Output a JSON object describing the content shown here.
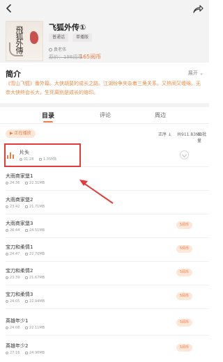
{
  "book": {
    "title": "飞狐外传①",
    "cover_text": "飛狐外傳",
    "tags": [
      "普通话",
      "单播版"
    ],
    "author": "袁老伟",
    "original_price": "原价：198阅币",
    "price": "165阅币"
  },
  "intro": {
    "heading": "简介",
    "expand_label": "展开",
    "text": "《雪山飞狐》番外篇。大侠胡斐的成长之路。江湖纷争夹杂着三角关系。又热闹又缠绵。无奈大侠终会长大，生死离别是成长的烙印。"
  },
  "tabs": [
    {
      "label": "目录"
    },
    {
      "label": "评论"
    },
    {
      "label": "周边"
    }
  ],
  "controls": {
    "play_label": "▶ 正在播放",
    "order_label": "正序 ↓",
    "total_label": "共911.83MB",
    "batch_label": "☰ 批量"
  },
  "episodes": [
    {
      "title": "片头",
      "duration": "01:28",
      "size": "1.35MB",
      "paid": ""
    },
    {
      "title": "大雨商家堡1",
      "duration": "24:36",
      "size": "22.31MB",
      "paid": ""
    },
    {
      "title": "大雨商家堡2",
      "duration": "23:42",
      "size": "21.71MB",
      "paid": ""
    },
    {
      "title": "大雨商家堡3",
      "duration": "26:44",
      "size": "24.51MB",
      "paid": "5阅币"
    },
    {
      "title": "宝刀和柔情1",
      "duration": "24:47",
      "size": "22.70MB",
      "paid": "5阅币"
    },
    {
      "title": "宝刀和柔情2",
      "duration": "23:39",
      "size": "21.67MB",
      "paid": "5阅币"
    },
    {
      "title": "宝刀和柔情3",
      "duration": "24:05",
      "size": "22.04MB",
      "paid": "5阅币"
    },
    {
      "title": "英雄年少1",
      "duration": "24:08",
      "size": "22.11MB",
      "paid": "5阅币"
    },
    {
      "title": "英雄年少2",
      "duration": "27:16",
      "size": "24.90MB",
      "paid": "5阅币"
    }
  ],
  "colors": {
    "accent": "#f07b3f",
    "highlight": "#e63a3a"
  }
}
